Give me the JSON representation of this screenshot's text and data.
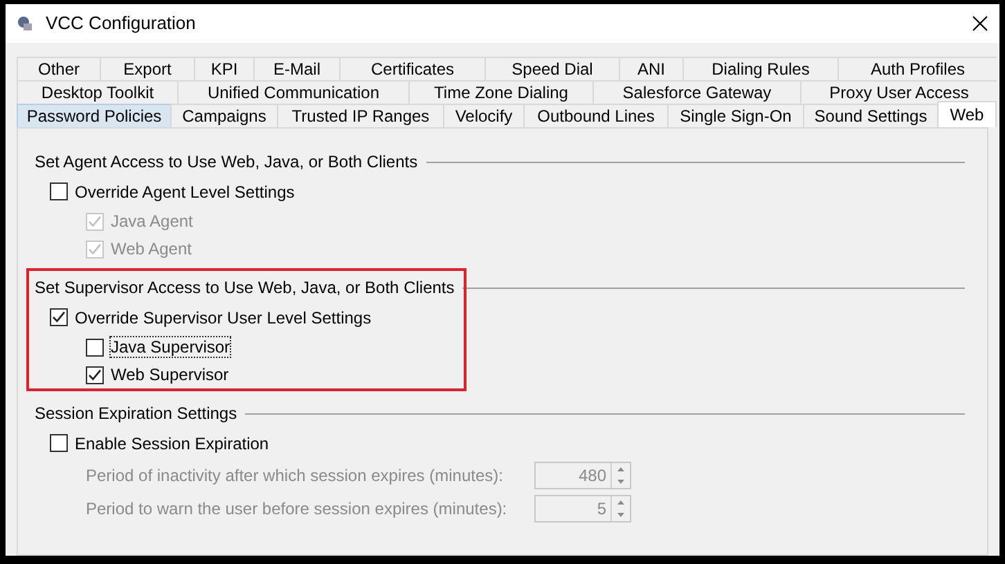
{
  "window": {
    "title": "VCC Configuration"
  },
  "tab_rows": [
    [
      {
        "label": "Other",
        "selected": false,
        "hovered": false
      },
      {
        "label": "Export",
        "selected": false,
        "hovered": false
      },
      {
        "label": "KPI",
        "selected": false,
        "hovered": false
      },
      {
        "label": "E-Mail",
        "selected": false,
        "hovered": false
      },
      {
        "label": "Certificates",
        "selected": false,
        "hovered": false
      },
      {
        "label": "Speed Dial",
        "selected": false,
        "hovered": false
      },
      {
        "label": "ANI",
        "selected": false,
        "hovered": false
      },
      {
        "label": "Dialing Rules",
        "selected": false,
        "hovered": false
      },
      {
        "label": "Auth Profiles",
        "selected": false,
        "hovered": false
      }
    ],
    [
      {
        "label": "Desktop Toolkit",
        "selected": false,
        "hovered": false
      },
      {
        "label": "Unified Communication",
        "selected": false,
        "hovered": false
      },
      {
        "label": "Time Zone Dialing",
        "selected": false,
        "hovered": false
      },
      {
        "label": "Salesforce Gateway",
        "selected": false,
        "hovered": false
      },
      {
        "label": "Proxy User Access",
        "selected": false,
        "hovered": false
      }
    ],
    [
      {
        "label": "Password Policies",
        "selected": false,
        "hovered": true
      },
      {
        "label": "Campaigns",
        "selected": false,
        "hovered": false
      },
      {
        "label": "Trusted IP Ranges",
        "selected": false,
        "hovered": false
      },
      {
        "label": "Velocify",
        "selected": false,
        "hovered": false
      },
      {
        "label": "Outbound Lines",
        "selected": false,
        "hovered": false
      },
      {
        "label": "Single Sign-On",
        "selected": false,
        "hovered": false
      },
      {
        "label": "Sound Settings",
        "selected": false,
        "hovered": false
      },
      {
        "label": "Web",
        "selected": true,
        "hovered": false
      }
    ]
  ],
  "groups": [
    {
      "title": "Set Agent Access to Use Web, Java, or Both Clients",
      "highlighted": false,
      "items": [
        {
          "kind": "checkbox",
          "label": "Override Agent Level Settings",
          "checked": false,
          "disabled": false,
          "focused": false,
          "children": [
            {
              "kind": "checkbox",
              "label": "Java Agent",
              "checked": true,
              "disabled": true,
              "focused": false
            },
            {
              "kind": "checkbox",
              "label": "Web Agent",
              "checked": true,
              "disabled": true,
              "focused": false
            }
          ]
        }
      ]
    },
    {
      "title": "Set Supervisor Access to Use Web, Java, or Both Clients",
      "highlighted": true,
      "items": [
        {
          "kind": "checkbox",
          "label": "Override Supervisor User Level Settings",
          "checked": true,
          "disabled": false,
          "focused": false,
          "children": [
            {
              "kind": "checkbox",
              "label": "Java Supervisor",
              "checked": false,
              "disabled": false,
              "focused": true
            },
            {
              "kind": "checkbox",
              "label": "Web Supervisor",
              "checked": true,
              "disabled": false,
              "focused": false
            }
          ]
        }
      ]
    },
    {
      "title": "Session Expiration Settings",
      "highlighted": false,
      "items": [
        {
          "kind": "checkbox",
          "label": "Enable Session Expiration",
          "checked": false,
          "disabled": false,
          "focused": false,
          "children": [
            {
              "kind": "spinner",
              "label": "Period of inactivity after which session expires (minutes):",
              "value": "480",
              "disabled": true
            },
            {
              "kind": "spinner",
              "label": "Period to warn the user before session expires (minutes):",
              "value": "5",
              "disabled": true
            }
          ]
        }
      ]
    }
  ]
}
